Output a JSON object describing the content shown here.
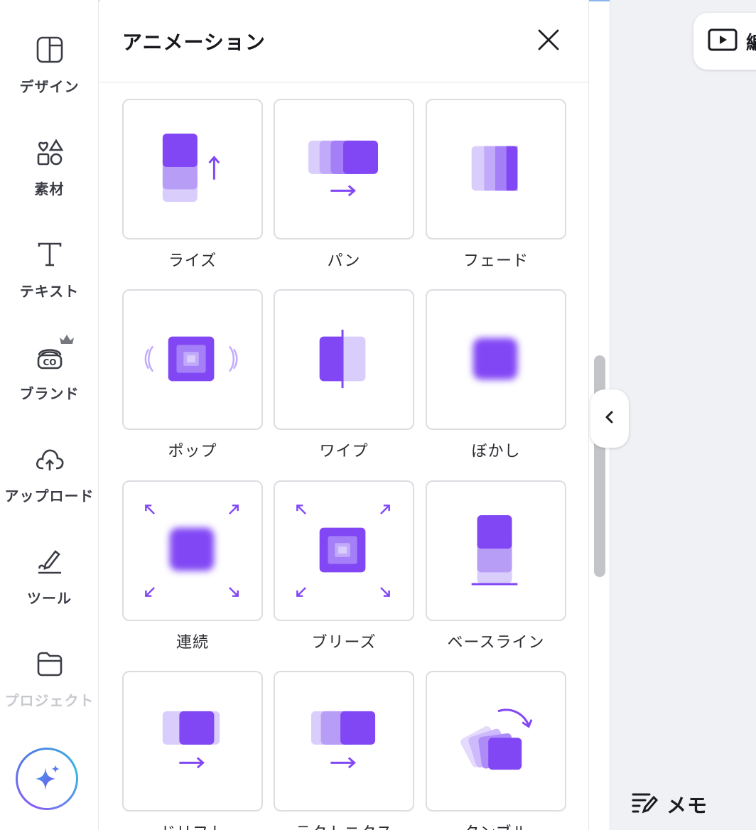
{
  "rail": {
    "items": [
      {
        "label": "デザイン",
        "icon": "layout-icon"
      },
      {
        "label": "素材",
        "icon": "elements-icon"
      },
      {
        "label": "テキスト",
        "icon": "text-icon"
      },
      {
        "label": "ブランド",
        "icon": "brand-icon"
      },
      {
        "label": "アップロード",
        "icon": "upload-cloud-icon"
      },
      {
        "label": "ツール",
        "icon": "pen-tool-icon"
      },
      {
        "label": "プロジェクト",
        "icon": "folder-icon"
      }
    ],
    "ai_button_icon": "sparkles-icon"
  },
  "panel": {
    "title": "アニメーション",
    "close_icon": "close-icon",
    "animations": [
      {
        "label": "ライズ"
      },
      {
        "label": "パン"
      },
      {
        "label": "フェード"
      },
      {
        "label": "ポップ"
      },
      {
        "label": "ワイプ"
      },
      {
        "label": "ぼかし"
      },
      {
        "label": "連続"
      },
      {
        "label": "ブリーズ"
      },
      {
        "label": "ベースライン"
      },
      {
        "label": "ドリフト"
      },
      {
        "label": "テクトニクス"
      },
      {
        "label": "タンブル"
      }
    ]
  },
  "canvas": {
    "present_label": "編",
    "memo_label": "メモ"
  },
  "colors": {
    "accent": "#8147f5",
    "accent_mid": "#a586f3",
    "accent_light": "#d9cdfb"
  }
}
